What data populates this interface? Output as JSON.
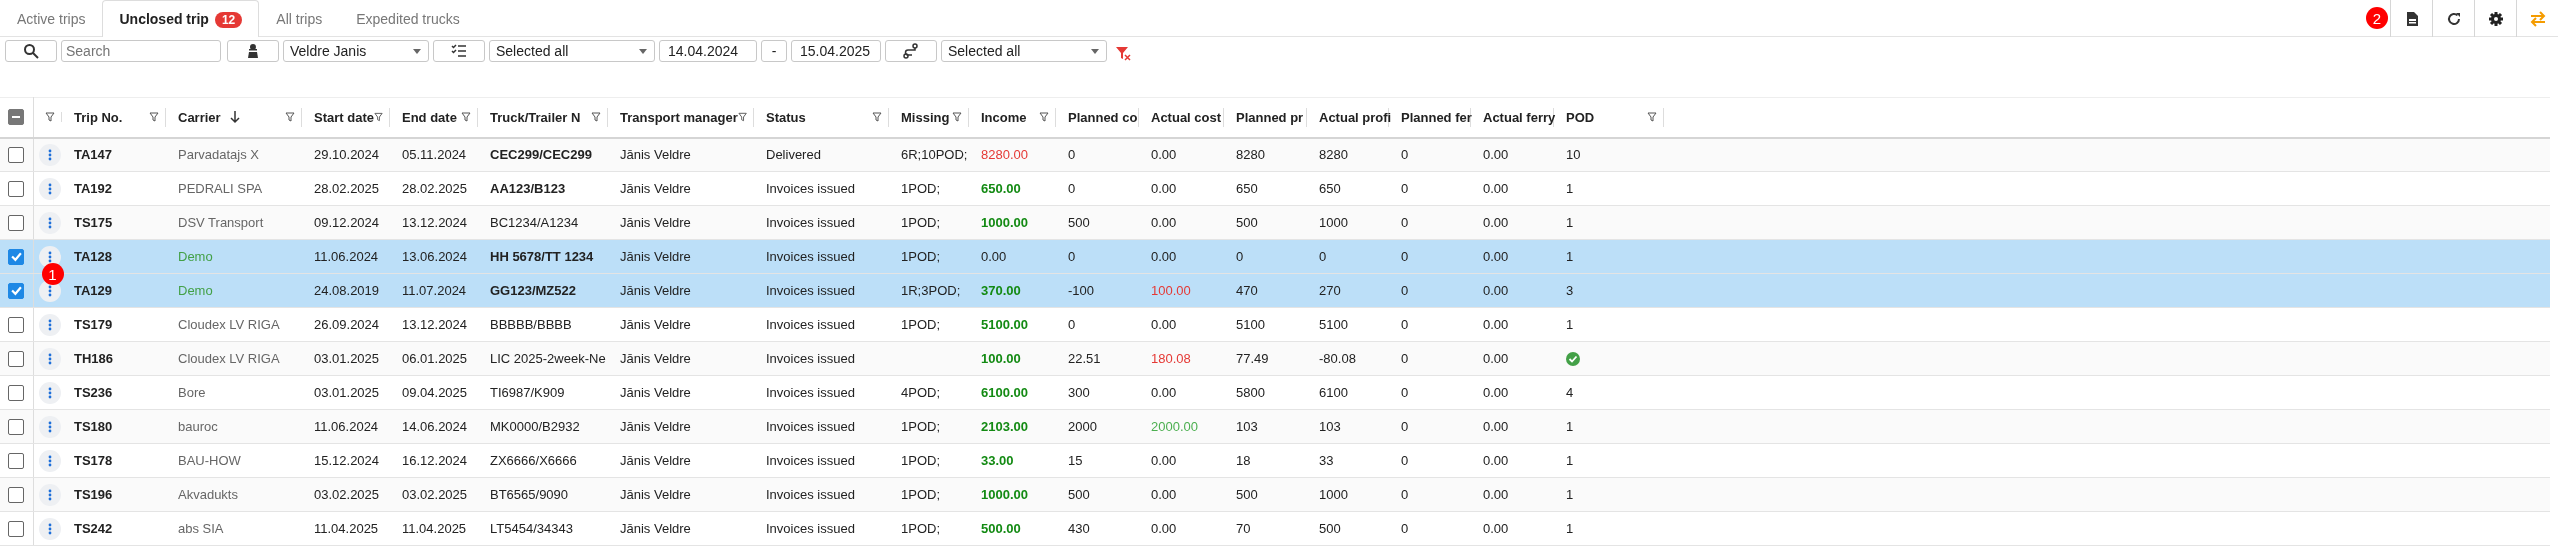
{
  "tabs": [
    {
      "label": "Active trips",
      "selected": false
    },
    {
      "label": "Unclosed trip",
      "selected": true,
      "badge": "12"
    },
    {
      "label": "All trips",
      "selected": false
    },
    {
      "label": "Expedited trucks",
      "selected": false
    }
  ],
  "toolbar": {
    "buttons": [
      {
        "kind": "export",
        "marker": "2"
      },
      {
        "kind": "refresh"
      },
      {
        "kind": "settings"
      },
      {
        "kind": "swap"
      }
    ]
  },
  "filters": {
    "search": {
      "placeholder": "Search"
    },
    "manager": "Veldre Janis",
    "status": "Selected all",
    "date_from": "14.04.2024",
    "date_separator": "-",
    "date_to": "15.04.2025",
    "route": "Selected all"
  },
  "table": {
    "header_indeterminate": true,
    "columns": [
      {
        "label": "Trip No."
      },
      {
        "label": "Carrier",
        "sorted_descending": true
      },
      {
        "label": "Start date"
      },
      {
        "label": "End date"
      },
      {
        "label": "Truck/Trailer N"
      },
      {
        "label": "Transport manager"
      },
      {
        "label": "Status"
      },
      {
        "label": "Missing"
      },
      {
        "label": "Income"
      },
      {
        "label": "Planned co"
      },
      {
        "label": "Actual cost"
      },
      {
        "label": "Planned pr"
      },
      {
        "label": "Actual profi"
      },
      {
        "label": "Planned fer"
      },
      {
        "label": "Actual ferry"
      },
      {
        "label": "POD"
      }
    ],
    "rows": [
      {
        "selected": false,
        "trip": "TA147",
        "carrier": "Parvadatajs X",
        "carrier_highlighted": false,
        "start": "29.10.2024",
        "end": "05.11.2024",
        "truck": "CEC299/CEC299",
        "truck_bold": true,
        "manager": "Jānis Veldre",
        "status": "Delivered",
        "missing": "6R;10POD;",
        "income": "8280.00",
        "income_negative": true,
        "income_positive": false,
        "planned_cost": "0",
        "actual_cost": "0.00",
        "actual_cost_negative": false,
        "actual_cost_positive": false,
        "planned_profit": "8280",
        "actual_profit": "8280",
        "planned_ferry": "0",
        "actual_ferry": "0.00",
        "pod": {
          "kind": "text",
          "text": "10"
        }
      },
      {
        "selected": false,
        "trip": "TA192",
        "carrier": "PEDRALI SPA",
        "carrier_highlighted": false,
        "start": "28.02.2025",
        "end": "28.02.2025",
        "truck": "AA123/B123",
        "truck_bold": true,
        "manager": "Jānis Veldre",
        "status": "Invoices issued",
        "missing": "1POD;",
        "income": "650.00",
        "income_negative": false,
        "income_positive": true,
        "planned_cost": "0",
        "actual_cost": "0.00",
        "actual_cost_negative": false,
        "actual_cost_positive": false,
        "planned_profit": "650",
        "actual_profit": "650",
        "planned_ferry": "0",
        "actual_ferry": "0.00",
        "pod": {
          "kind": "text",
          "text": "1"
        }
      },
      {
        "selected": false,
        "trip": "TS175",
        "carrier": "DSV Transport",
        "carrier_highlighted": false,
        "start": "09.12.2024",
        "end": "13.12.2024",
        "truck": "BC1234/A1234",
        "truck_bold": false,
        "manager": "Jānis Veldre",
        "status": "Invoices issued",
        "missing": "1POD;",
        "income": "1000.00",
        "income_negative": false,
        "income_positive": true,
        "planned_cost": "500",
        "actual_cost": "0.00",
        "actual_cost_negative": false,
        "actual_cost_positive": false,
        "planned_profit": "500",
        "actual_profit": "1000",
        "planned_ferry": "0",
        "actual_ferry": "0.00",
        "pod": {
          "kind": "text",
          "text": "1"
        }
      },
      {
        "selected": true,
        "marker": "1",
        "trip": "TA128",
        "carrier": "Demo",
        "carrier_highlighted": true,
        "start": "11.06.2024",
        "end": "13.06.2024",
        "truck": "HH 5678/TT 1234",
        "truck_bold": true,
        "manager": "Jānis Veldre",
        "status": "Invoices issued",
        "missing": "1POD;",
        "income": "0.00",
        "income_negative": false,
        "income_positive": false,
        "planned_cost": "0",
        "actual_cost": "0.00",
        "actual_cost_negative": false,
        "actual_cost_positive": false,
        "planned_profit": "0",
        "actual_profit": "0",
        "planned_ferry": "0",
        "actual_ferry": "0.00",
        "pod": {
          "kind": "text",
          "text": "1"
        }
      },
      {
        "selected": true,
        "trip": "TA129",
        "carrier": "Demo",
        "carrier_highlighted": true,
        "start": "24.08.2019",
        "end": "11.07.2024",
        "truck": "GG123/MZ522",
        "truck_bold": true,
        "manager": "Jānis Veldre",
        "status": "Invoices issued",
        "missing": "1R;3POD;",
        "income": "370.00",
        "income_negative": false,
        "income_positive": true,
        "planned_cost": "-100",
        "actual_cost": "100.00",
        "actual_cost_negative": true,
        "actual_cost_positive": false,
        "planned_profit": "470",
        "actual_profit": "270",
        "planned_ferry": "0",
        "actual_ferry": "0.00",
        "pod": {
          "kind": "text",
          "text": "3"
        }
      },
      {
        "selected": false,
        "trip": "TS179",
        "carrier": "Cloudex LV RIGA",
        "carrier_highlighted": false,
        "start": "26.09.2024",
        "end": "13.12.2024",
        "truck": "BBBBB/BBBB",
        "truck_bold": false,
        "manager": "Jānis Veldre",
        "status": "Invoices issued",
        "missing": "1POD;",
        "income": "5100.00",
        "income_negative": false,
        "income_positive": true,
        "planned_cost": "0",
        "actual_cost": "0.00",
        "actual_cost_negative": false,
        "actual_cost_positive": false,
        "planned_profit": "5100",
        "actual_profit": "5100",
        "planned_ferry": "0",
        "actual_ferry": "0.00",
        "pod": {
          "kind": "text",
          "text": "1"
        }
      },
      {
        "selected": false,
        "trip": "TH186",
        "carrier": "Cloudex LV RIGA",
        "carrier_highlighted": false,
        "start": "03.01.2025",
        "end": "06.01.2025",
        "truck": "LIC 2025-2week-Ne",
        "truck_bold": false,
        "manager": "Jānis Veldre",
        "status": "Invoices issued",
        "income": "100.00",
        "income_negative": false,
        "income_positive": true,
        "planned_cost": "22.51",
        "actual_cost": "180.08",
        "actual_cost_negative": true,
        "actual_cost_positive": false,
        "planned_profit": "77.49",
        "actual_profit": "-80.08",
        "planned_ferry": "0",
        "actual_ferry": "0.00",
        "pod": {
          "kind": "check"
        }
      },
      {
        "selected": false,
        "trip": "TS236",
        "carrier": "Bore",
        "carrier_highlighted": false,
        "start": "03.01.2025",
        "end": "09.04.2025",
        "truck": "TI6987/K909",
        "truck_bold": false,
        "manager": "Jānis Veldre",
        "status": "Invoices issued",
        "missing": "4POD;",
        "income": "6100.00",
        "income_negative": false,
        "income_positive": true,
        "planned_cost": "300",
        "actual_cost": "0.00",
        "actual_cost_negative": false,
        "actual_cost_positive": false,
        "planned_profit": "5800",
        "actual_profit": "6100",
        "planned_ferry": "0",
        "actual_ferry": "0.00",
        "pod": {
          "kind": "text",
          "text": "4"
        }
      },
      {
        "selected": false,
        "trip": "TS180",
        "carrier": "bauroc",
        "carrier_highlighted": false,
        "start": "11.06.2024",
        "end": "14.06.2024",
        "truck": "MK0000/B2932",
        "truck_bold": false,
        "manager": "Jānis Veldre",
        "status": "Invoices issued",
        "missing": "1POD;",
        "income": "2103.00",
        "income_negative": false,
        "income_positive": true,
        "planned_cost": "2000",
        "actual_cost": "2000.00",
        "actual_cost_negative": false,
        "actual_cost_positive": true,
        "planned_profit": "103",
        "actual_profit": "103",
        "planned_ferry": "0",
        "actual_ferry": "0.00",
        "pod": {
          "kind": "text",
          "text": "1"
        }
      },
      {
        "selected": false,
        "trip": "TS178",
        "carrier": "BAU-HOW",
        "carrier_highlighted": false,
        "start": "15.12.2024",
        "end": "16.12.2024",
        "truck": "ZX6666/X6666",
        "truck_bold": false,
        "manager": "Jānis Veldre",
        "status": "Invoices issued",
        "missing": "1POD;",
        "income": "33.00",
        "income_negative": false,
        "income_positive": true,
        "planned_cost": "15",
        "actual_cost": "0.00",
        "actual_cost_negative": false,
        "actual_cost_positive": false,
        "planned_profit": "18",
        "actual_profit": "33",
        "planned_ferry": "0",
        "actual_ferry": "0.00",
        "pod": {
          "kind": "text",
          "text": "1"
        }
      },
      {
        "selected": false,
        "trip": "TS196",
        "carrier": "Akvadukts",
        "carrier_highlighted": false,
        "start": "03.02.2025",
        "end": "03.02.2025",
        "truck": "BT6565/9090",
        "truck_bold": false,
        "manager": "Jānis Veldre",
        "status": "Invoices issued",
        "missing": "1POD;",
        "income": "1000.00",
        "income_negative": false,
        "income_positive": true,
        "planned_cost": "500",
        "actual_cost": "0.00",
        "actual_cost_negative": false,
        "actual_cost_positive": false,
        "planned_profit": "500",
        "actual_profit": "1000",
        "planned_ferry": "0",
        "actual_ferry": "0.00",
        "pod": {
          "kind": "text",
          "text": "1"
        }
      },
      {
        "selected": false,
        "trip": "TS242",
        "carrier": "abs SIA",
        "carrier_highlighted": false,
        "start": "11.04.2025",
        "end": "11.04.2025",
        "truck": "LT5454/34343",
        "truck_bold": false,
        "manager": "Jānis Veldre",
        "status": "Invoices issued",
        "missing": "1POD;",
        "income": "500.00",
        "income_negative": false,
        "income_positive": true,
        "planned_cost": "430",
        "actual_cost": "0.00",
        "actual_cost_negative": false,
        "actual_cost_positive": false,
        "planned_profit": "70",
        "actual_profit": "500",
        "planned_ferry": "0",
        "actual_ferry": "0.00",
        "pod": {
          "kind": "text",
          "text": "1"
        }
      }
    ]
  }
}
